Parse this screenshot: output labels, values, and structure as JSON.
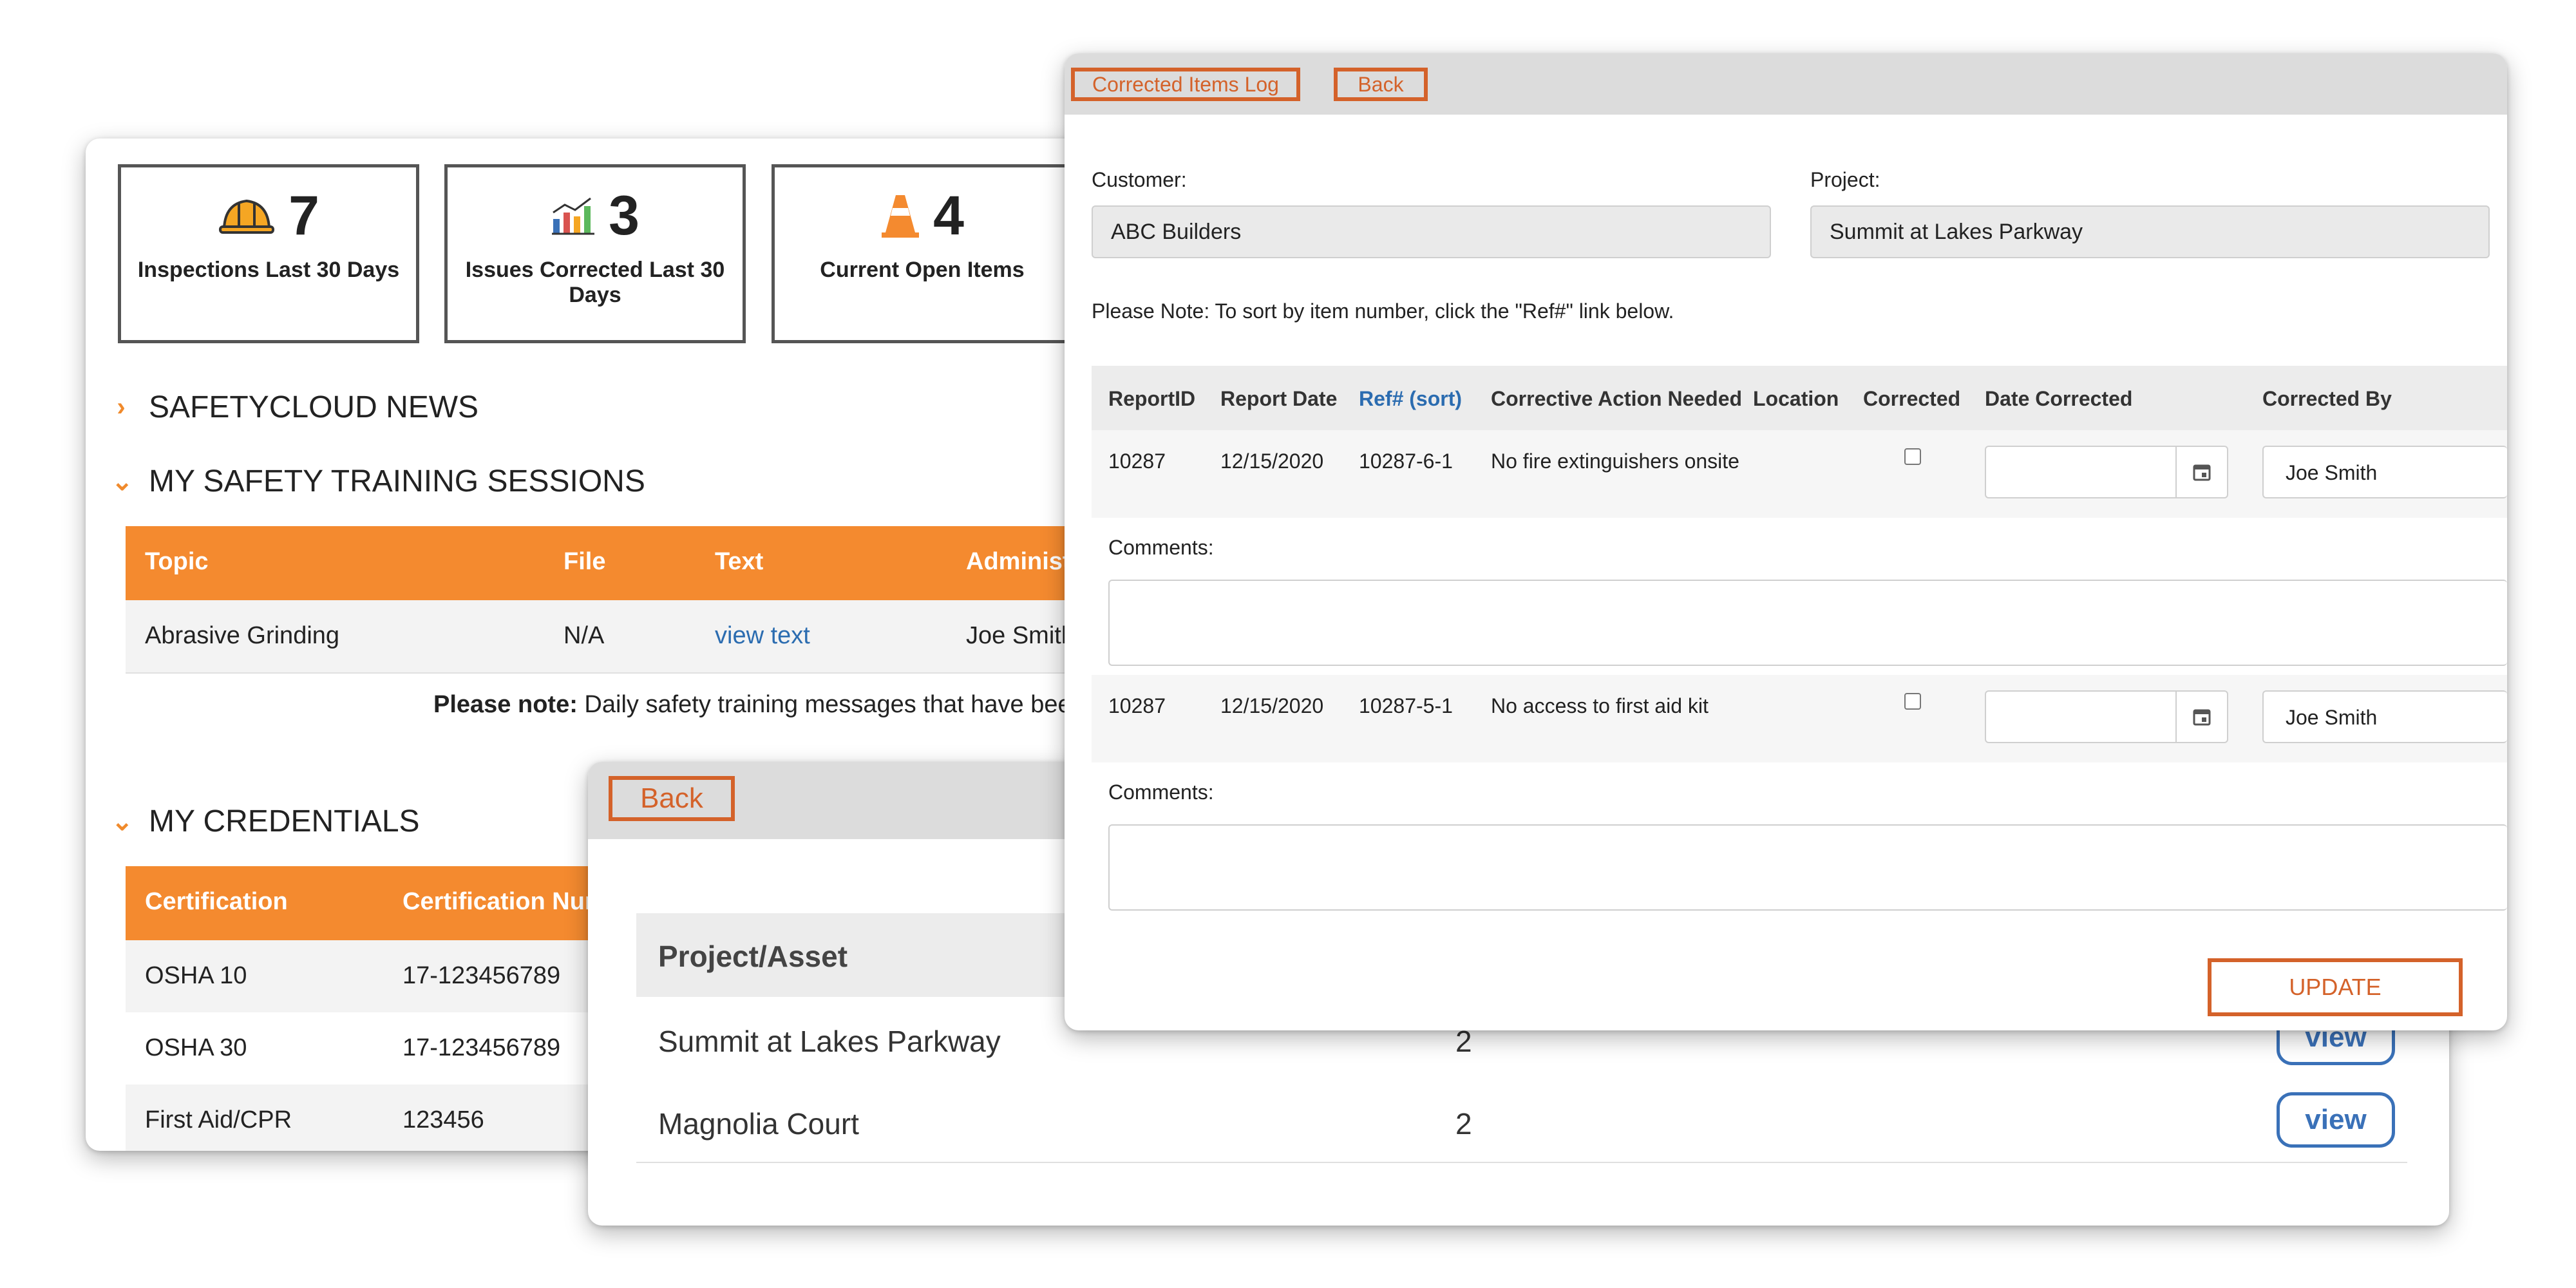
{
  "dashboard": {
    "stats": [
      {
        "icon": "hard-hat-icon",
        "value": "7",
        "label": "Inspections Last 30 Days"
      },
      {
        "icon": "chart-icon",
        "value": "3",
        "label": "Issues Corrected Last 30 Days"
      },
      {
        "icon": "traffic-cone-icon",
        "value": "4",
        "label": "Current Open Items"
      }
    ],
    "sections": {
      "news": "SAFETYCLOUD NEWS",
      "training": "MY SAFETY TRAINING SESSIONS",
      "credentials": "MY CREDENTIALS"
    },
    "training_table": {
      "headers": [
        "Topic",
        "File",
        "Text",
        "Administe"
      ],
      "rows": [
        {
          "topic": "Abrasive Grinding",
          "file": "N/A",
          "text": "view text",
          "admin": "Joe Smith"
        }
      ]
    },
    "training_note": {
      "bold": "Please note:",
      "text": " Daily safety training messages that have been sig"
    },
    "credentials_table": {
      "headers": [
        "Certification",
        "Certification Num"
      ],
      "rows": [
        {
          "cert": "OSHA 10",
          "num": "17-123456789"
        },
        {
          "cert": "OSHA 30",
          "num": "17-123456789"
        },
        {
          "cert": "First Aid/CPR",
          "num": "123456"
        }
      ]
    }
  },
  "project_panel": {
    "back": "Back",
    "header": "Project/Asset",
    "rows": [
      {
        "name": "Summit at Lakes Parkway",
        "count": "2",
        "action": "view"
      },
      {
        "name": "Magnolia Court",
        "count": "2",
        "action": "view"
      }
    ]
  },
  "log_panel": {
    "tabs": {
      "log": "Corrected Items Log",
      "back": "Back"
    },
    "customer": {
      "label": "Customer:",
      "value": "ABC Builders"
    },
    "project": {
      "label": "Project:",
      "value": "Summit at Lakes Parkway"
    },
    "note": "Please Note: To sort by item number, click the \"Ref#\" link below.",
    "headers": [
      "ReportID",
      "Report Date",
      "Ref# (sort)",
      "Corrective Action Needed",
      "Location",
      "Corrected",
      "Date Corrected",
      "Corrected By"
    ],
    "items": [
      {
        "report_id": "10287",
        "date": "12/15/2020",
        "ref": "10287-6-1",
        "action": "No fire extinguishers onsite",
        "corrected_by": "Joe Smith",
        "comments_label": "Comments:"
      },
      {
        "report_id": "10287",
        "date": "12/15/2020",
        "ref": "10287-5-1",
        "action": "No access to first aid kit",
        "corrected_by": "Joe Smith",
        "comments_label": "Comments:"
      }
    ],
    "update": "UPDATE"
  },
  "colors": {
    "orange": "#f48a2f",
    "accent": "#d4622a",
    "link": "#2b6cb0"
  }
}
